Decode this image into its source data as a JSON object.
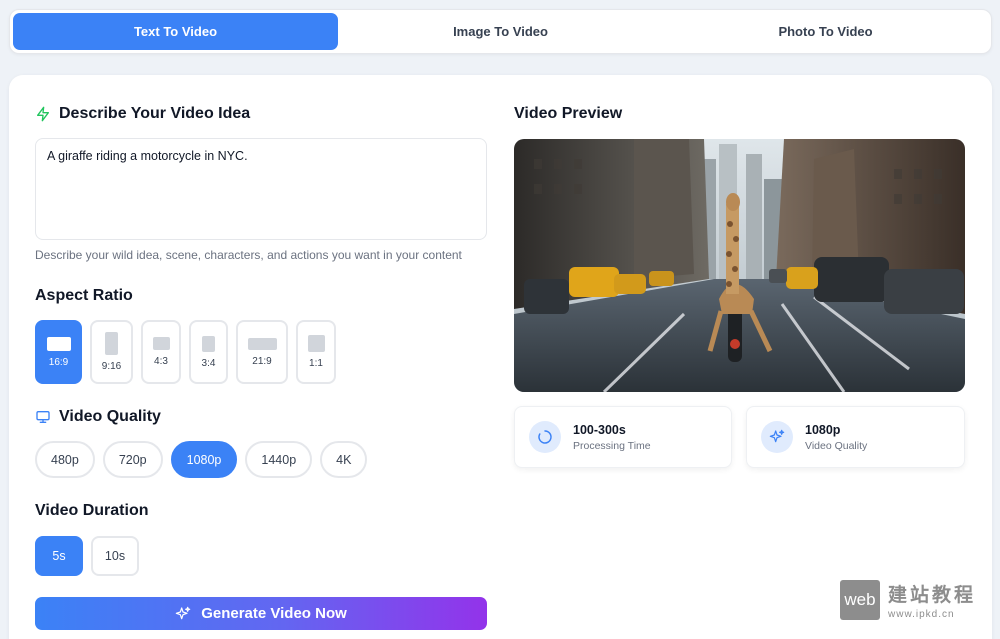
{
  "tabs": [
    {
      "label": "Text To Video",
      "active": true
    },
    {
      "label": "Image To Video",
      "active": false
    },
    {
      "label": "Photo To Video",
      "active": false
    }
  ],
  "idea": {
    "title": "Describe Your Video Idea",
    "value": "A giraffe riding a motorcycle in NYC.",
    "helper": "Describe your wild idea, scene, characters, and actions you want in your content"
  },
  "aspect": {
    "title": "Aspect Ratio",
    "options": [
      "16:9",
      "9:16",
      "4:3",
      "3:4",
      "21:9",
      "1:1"
    ],
    "selected": "16:9"
  },
  "quality": {
    "title": "Video Quality",
    "options": [
      "480p",
      "720p",
      "1080p",
      "1440p",
      "4K"
    ],
    "selected": "1080p"
  },
  "duration": {
    "title": "Video Duration",
    "options": [
      "5s",
      "10s"
    ],
    "selected": "5s"
  },
  "generate_label": "Generate Video Now",
  "preview": {
    "title": "Video Preview"
  },
  "stats": [
    {
      "value": "100-300s",
      "label": "Processing Time",
      "icon": "loading-spinner-icon"
    },
    {
      "value": "1080p",
      "label": "Video Quality",
      "icon": "sparkles-icon"
    }
  ],
  "watermark": {
    "logo_text": "web",
    "cn_text": "建站教程",
    "url": "www.ipkd.cn"
  },
  "colors": {
    "accent": "#3b82f6",
    "gradient_end": "#9333ea",
    "zap_icon": "#22c55e"
  }
}
